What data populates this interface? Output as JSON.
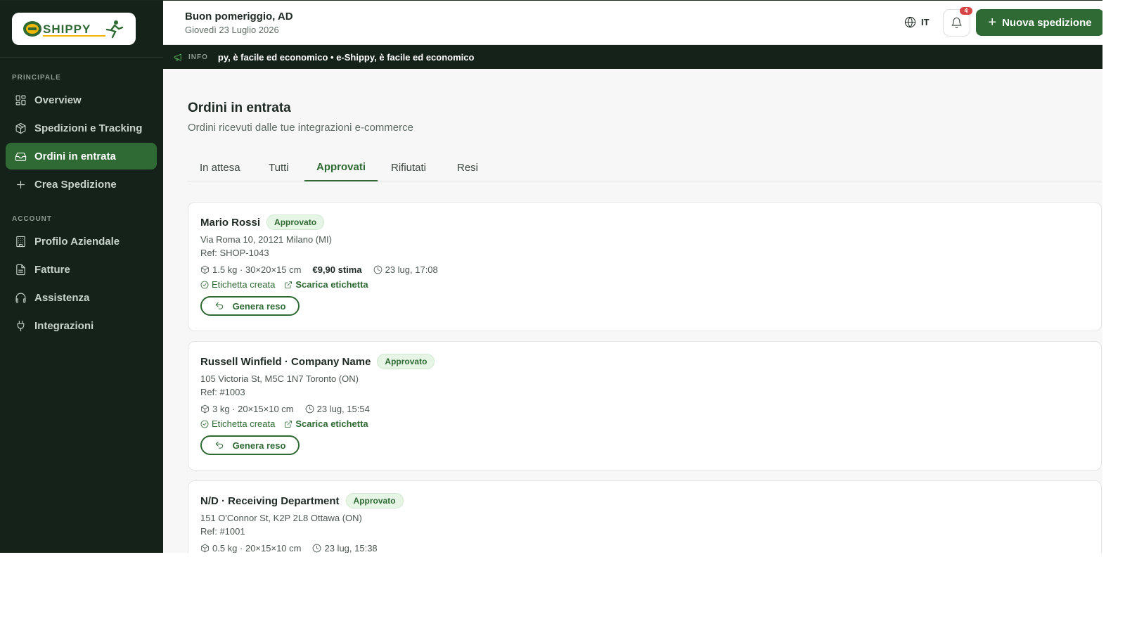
{
  "brand": {
    "logo_text": "e-SHIPPY",
    "accent": "#2f6a34",
    "sidebar_bg": "#152219"
  },
  "sidebar": {
    "sections": [
      {
        "title": "PRINCIPALE",
        "items": [
          {
            "label": "Overview",
            "icon": "grid-icon"
          },
          {
            "label": "Spedizioni e Tracking",
            "icon": "package-icon"
          },
          {
            "label": "Ordini in entrata",
            "icon": "inbox-icon",
            "active": true
          },
          {
            "label": "Crea Spedizione",
            "icon": "plus-icon"
          }
        ]
      },
      {
        "title": "ACCOUNT",
        "items": [
          {
            "label": "Profilo Aziendale",
            "icon": "building-icon"
          },
          {
            "label": "Fatture",
            "icon": "file-icon"
          },
          {
            "label": "Assistenza",
            "icon": "headphones-icon"
          },
          {
            "label": "Integrazioni",
            "icon": "plug-icon"
          }
        ]
      }
    ]
  },
  "header": {
    "greeting": "Buon pomeriggio, AD",
    "date": "Giovedì 23 Luglio 2026",
    "language": "IT",
    "notifications": "4",
    "new_shipment": "Nuova spedizione"
  },
  "ticker": {
    "tag": "INFO",
    "text": "py, è facile ed economico • e-Shippy, è facile ed economico"
  },
  "page": {
    "title": "Ordini in entrata",
    "subtitle": "Ordini ricevuti dalle tue integrazioni e-commerce",
    "tabs": [
      {
        "label": "In attesa"
      },
      {
        "label": "Tutti"
      },
      {
        "label": "Approvati",
        "active": true
      },
      {
        "label": "Rifiutati"
      },
      {
        "label": "Resi"
      }
    ]
  },
  "orders": [
    {
      "name": "Mario Rossi",
      "status": "Approvato",
      "address": "Via Roma 10, 20121 Milano (MI)",
      "ref": "Ref: SHOP-1043",
      "package": "1.5 kg · 30×20×15 cm",
      "cost": "€9,90 stima",
      "time": "23 lug, 17:08",
      "label_status": "Etichetta creata",
      "download": "Scarica etichetta",
      "action": "Genera reso"
    },
    {
      "name": "Russell Winfield · Company Name",
      "status": "Approvato",
      "address": "105 Victoria St, M5C 1N7 Toronto (ON)",
      "ref": "Ref: #1003",
      "package": "3 kg · 20×15×10 cm",
      "time": "23 lug, 15:54",
      "label_status": "Etichetta creata",
      "download": "Scarica etichetta",
      "action": "Genera reso"
    },
    {
      "name": "N/D · Receiving Department",
      "status": "Approvato",
      "address": "151 O'Connor St, K2P 2L8 Ottawa (ON)",
      "ref": "Ref: #1001",
      "package": "0.5 kg · 20×15×10 cm",
      "time": "23 lug, 15:38"
    }
  ]
}
